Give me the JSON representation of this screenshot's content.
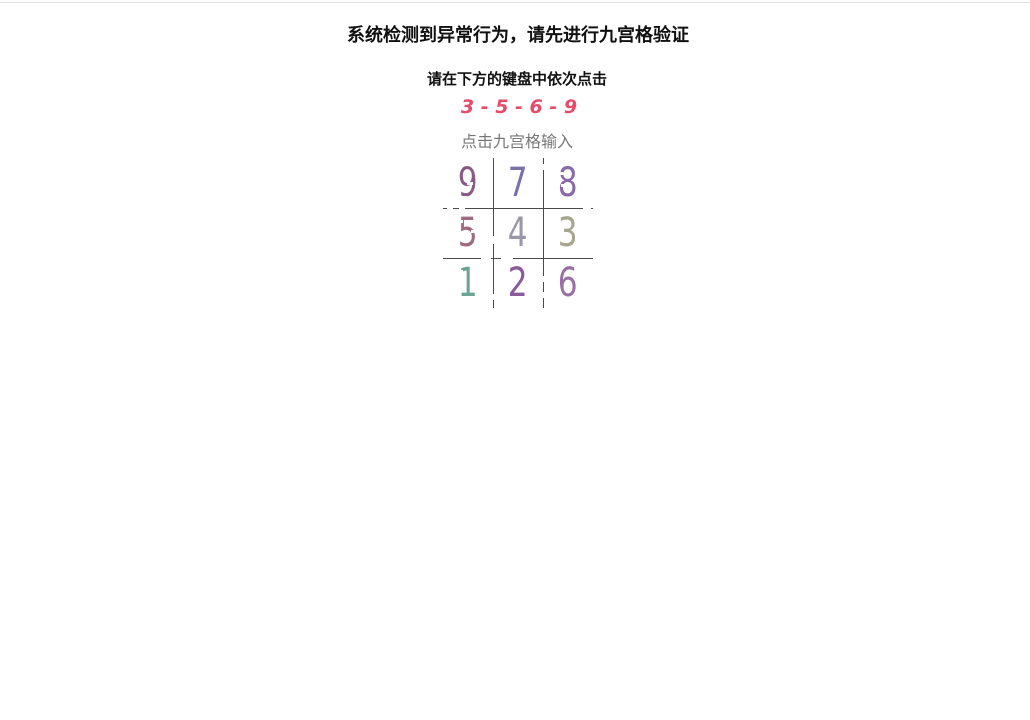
{
  "page": {
    "title": "系统检测到异常行为，请先进行九宫格验证",
    "instruction": "请在下方的键盘中依次点击",
    "sequence": "3 - 5 - 6 - 9",
    "hint": "点击九宫格输入"
  },
  "colors": {
    "sequence": "#e84a6a",
    "hint": "#777777"
  },
  "keypad": {
    "rows": [
      [
        {
          "digit": "9",
          "color": "#8a5a86"
        },
        {
          "digit": "7",
          "color": "#7a70ac"
        },
        {
          "digit": "8",
          "color": "#8a6aa6"
        }
      ],
      [
        {
          "digit": "5",
          "color": "#a06a82"
        },
        {
          "digit": "4",
          "color": "#9a98a8"
        },
        {
          "digit": "3",
          "color": "#a6a68e"
        }
      ],
      [
        {
          "digit": "1",
          "color": "#6aa494"
        },
        {
          "digit": "2",
          "color": "#8a5a9a"
        },
        {
          "digit": "6",
          "color": "#9a70a4"
        }
      ]
    ]
  }
}
